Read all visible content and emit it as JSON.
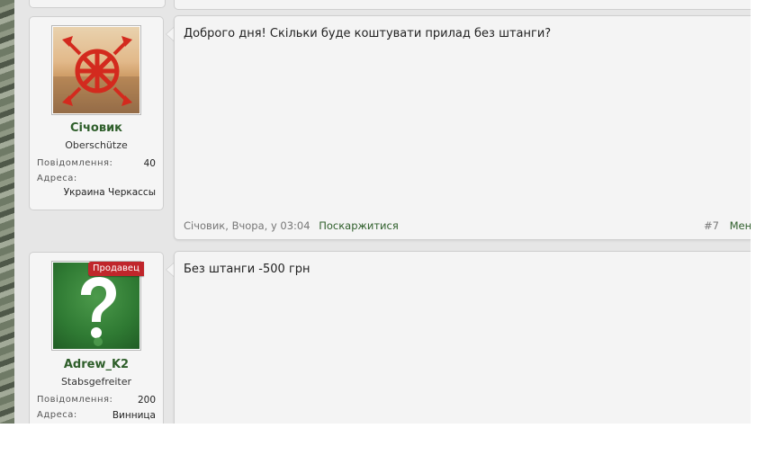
{
  "posts": [
    {
      "author": "Січовик",
      "user_title": "Oberschütze",
      "stats": [
        {
          "label": "Повідомлення:",
          "value": "40"
        },
        {
          "label": "Адреса:",
          "value": ""
        },
        {
          "label": "",
          "value": "Украина Черкассы"
        }
      ],
      "content": "Доброго дня! Скільки буде коштувати прилад без штанги?",
      "footer_author_time": "Січовик, Вчора, у 03:04",
      "report_label": "Поскаржитися",
      "post_number": "#7",
      "menu_label": "Мені"
    },
    {
      "author": "Adrew_K2",
      "user_title": "Stabsgefreiter",
      "badge": "Продавец",
      "stats": [
        {
          "label": "Повідомлення:",
          "value": "200"
        },
        {
          "label": "Адреса:",
          "value": "Винница"
        }
      ],
      "content": "Без штанги -500 грн"
    }
  ],
  "colors": {
    "username": "#2e5e2a",
    "badge": "#c0262b",
    "background": "#e6e6e6"
  },
  "icons": {
    "avatar1": "kolovrat-symbol",
    "avatar2": "question-mark"
  }
}
